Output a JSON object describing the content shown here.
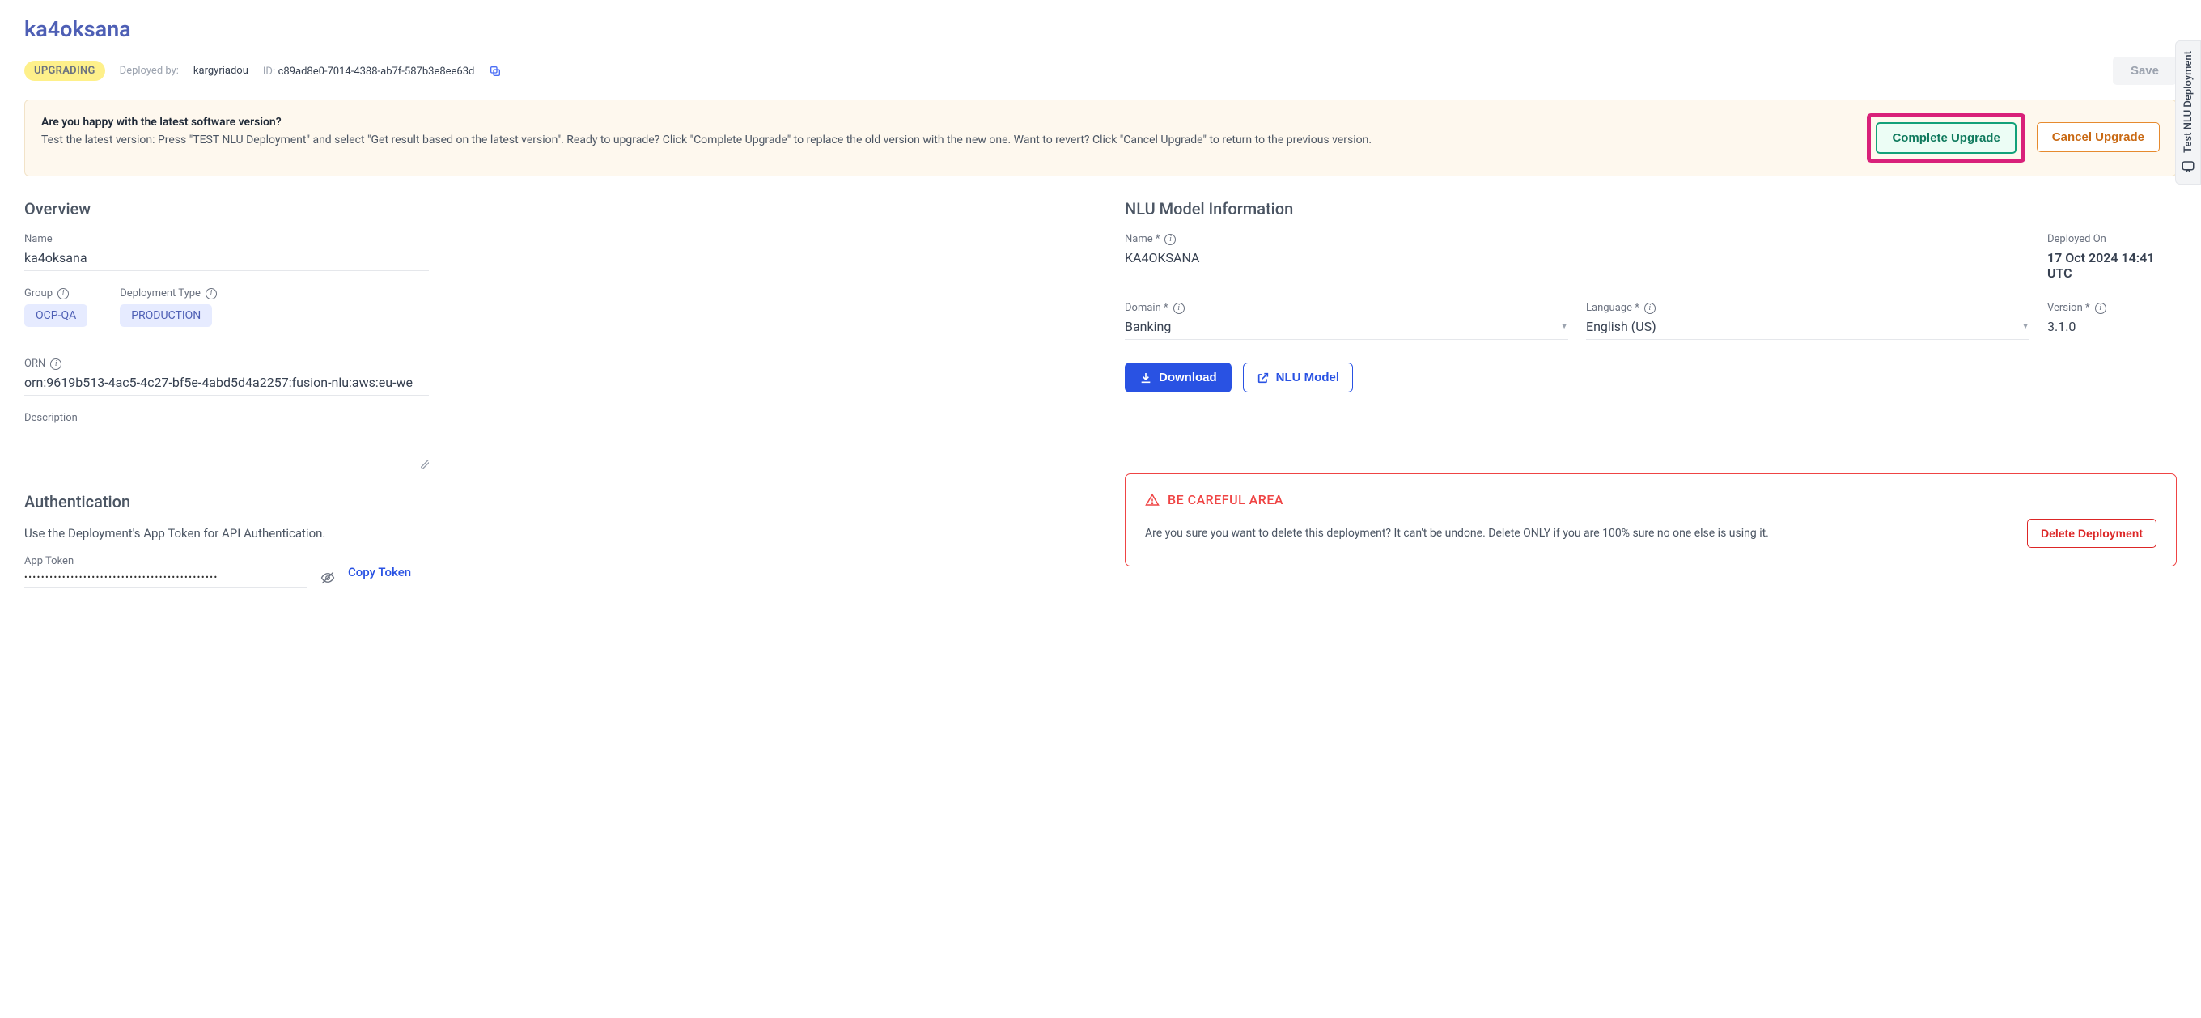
{
  "title": "ka4oksana",
  "header": {
    "status_badge": "UPGRADING",
    "deployed_by_label": "Deployed by:",
    "deployed_by_value": "kargyriadou",
    "id_label": "ID:",
    "id_value": "c89ad8e0-7014-4388-ab7f-587b3e8ee63d",
    "save_label": "Save"
  },
  "banner": {
    "question": "Are you happy with the latest software version?",
    "body": "Test the latest version: Press \"TEST NLU Deployment\" and select \"Get result based on the latest version\". Ready to upgrade? Click \"Complete Upgrade\" to replace the old version with the new one. Want to revert? Click \"Cancel Upgrade\" to return to the previous version.",
    "complete_label": "Complete Upgrade",
    "cancel_label": "Cancel Upgrade"
  },
  "overview": {
    "heading": "Overview",
    "name_label": "Name",
    "name_value": "ka4oksana",
    "group_label": "Group",
    "group_value": "OCP-QA",
    "deploy_type_label": "Deployment Type",
    "deploy_type_value": "PRODUCTION",
    "orn_label": "ORN",
    "orn_value": "orn:9619b513-4ac5-4c27-bf5e-4abd5d4a2257:fusion-nlu:aws:eu-we",
    "description_label": "Description"
  },
  "auth": {
    "heading": "Authentication",
    "desc": "Use the Deployment's App Token for API Authentication.",
    "token_label": "App Token",
    "token_mask": "••••••••••••••••••••••••••••••••••••••••••••••",
    "copy_label": "Copy Token"
  },
  "model": {
    "heading": "NLU Model Information",
    "name_label": "Name *",
    "name_value": "KA4OKSANA",
    "deployed_on_label": "Deployed On",
    "deployed_on_value": "17 Oct 2024 14:41 UTC",
    "domain_label": "Domain *",
    "domain_value": "Banking",
    "language_label": "Language *",
    "language_value": "English (US)",
    "version_label": "Version *",
    "version_value": "3.1.0",
    "download_label": "Download",
    "nlu_model_label": "NLU Model"
  },
  "danger": {
    "heading": "BE CAREFUL AREA",
    "text": "Are you sure you want to delete this deployment? It can't be undone. Delete ONLY if you are 100% sure no one else is using it.",
    "delete_label": "Delete Deployment"
  },
  "rail": {
    "label": "Test NLU Deployment"
  }
}
